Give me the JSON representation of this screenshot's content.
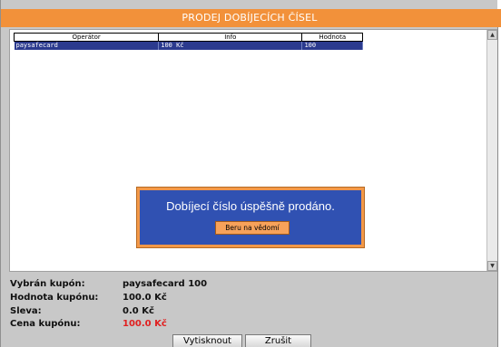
{
  "window": {
    "title": "PRODEJ DOBÍJECÍCH ČÍSEL"
  },
  "table": {
    "columns": [
      "Operátor",
      "Info",
      "Hodnota"
    ],
    "rows": [
      {
        "operator": "paysafecard",
        "info": "100 Kč",
        "value": "100",
        "selected": true
      }
    ]
  },
  "dialog": {
    "message": "Dobíjecí číslo úspěšně prodáno.",
    "ok_label": "Beru na vědomí"
  },
  "summary": {
    "coupon_label": "Vybrán kupón:",
    "coupon_value": "paysafecard 100",
    "face_label": "Hodnota kupónu:",
    "face_value": "100.0 Kč",
    "discount_label": "Sleva:",
    "discount_value": "0.0 Kč",
    "price_label": "Cena kupónu:",
    "price_value": "100.0 Kč"
  },
  "buttons": {
    "print": "Vytisknout",
    "cancel": "Zrušit"
  },
  "colors": {
    "accent": "#f2913a",
    "dialog_bg": "#3051b2",
    "price": "#e02020"
  }
}
